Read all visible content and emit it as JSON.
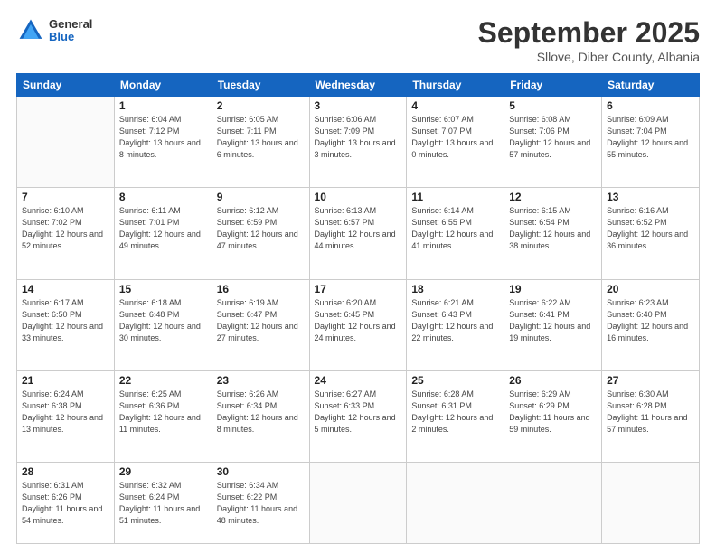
{
  "header": {
    "logo_general": "General",
    "logo_blue": "Blue",
    "month_title": "September 2025",
    "location": "Sllove, Diber County, Albania"
  },
  "weekdays": [
    "Sunday",
    "Monday",
    "Tuesday",
    "Wednesday",
    "Thursday",
    "Friday",
    "Saturday"
  ],
  "weeks": [
    [
      {
        "day": "",
        "sunrise": "",
        "sunset": "",
        "daylight": ""
      },
      {
        "day": "1",
        "sunrise": "Sunrise: 6:04 AM",
        "sunset": "Sunset: 7:12 PM",
        "daylight": "Daylight: 13 hours and 8 minutes."
      },
      {
        "day": "2",
        "sunrise": "Sunrise: 6:05 AM",
        "sunset": "Sunset: 7:11 PM",
        "daylight": "Daylight: 13 hours and 6 minutes."
      },
      {
        "day": "3",
        "sunrise": "Sunrise: 6:06 AM",
        "sunset": "Sunset: 7:09 PM",
        "daylight": "Daylight: 13 hours and 3 minutes."
      },
      {
        "day": "4",
        "sunrise": "Sunrise: 6:07 AM",
        "sunset": "Sunset: 7:07 PM",
        "daylight": "Daylight: 13 hours and 0 minutes."
      },
      {
        "day": "5",
        "sunrise": "Sunrise: 6:08 AM",
        "sunset": "Sunset: 7:06 PM",
        "daylight": "Daylight: 12 hours and 57 minutes."
      },
      {
        "day": "6",
        "sunrise": "Sunrise: 6:09 AM",
        "sunset": "Sunset: 7:04 PM",
        "daylight": "Daylight: 12 hours and 55 minutes."
      }
    ],
    [
      {
        "day": "7",
        "sunrise": "Sunrise: 6:10 AM",
        "sunset": "Sunset: 7:02 PM",
        "daylight": "Daylight: 12 hours and 52 minutes."
      },
      {
        "day": "8",
        "sunrise": "Sunrise: 6:11 AM",
        "sunset": "Sunset: 7:01 PM",
        "daylight": "Daylight: 12 hours and 49 minutes."
      },
      {
        "day": "9",
        "sunrise": "Sunrise: 6:12 AM",
        "sunset": "Sunset: 6:59 PM",
        "daylight": "Daylight: 12 hours and 47 minutes."
      },
      {
        "day": "10",
        "sunrise": "Sunrise: 6:13 AM",
        "sunset": "Sunset: 6:57 PM",
        "daylight": "Daylight: 12 hours and 44 minutes."
      },
      {
        "day": "11",
        "sunrise": "Sunrise: 6:14 AM",
        "sunset": "Sunset: 6:55 PM",
        "daylight": "Daylight: 12 hours and 41 minutes."
      },
      {
        "day": "12",
        "sunrise": "Sunrise: 6:15 AM",
        "sunset": "Sunset: 6:54 PM",
        "daylight": "Daylight: 12 hours and 38 minutes."
      },
      {
        "day": "13",
        "sunrise": "Sunrise: 6:16 AM",
        "sunset": "Sunset: 6:52 PM",
        "daylight": "Daylight: 12 hours and 36 minutes."
      }
    ],
    [
      {
        "day": "14",
        "sunrise": "Sunrise: 6:17 AM",
        "sunset": "Sunset: 6:50 PM",
        "daylight": "Daylight: 12 hours and 33 minutes."
      },
      {
        "day": "15",
        "sunrise": "Sunrise: 6:18 AM",
        "sunset": "Sunset: 6:48 PM",
        "daylight": "Daylight: 12 hours and 30 minutes."
      },
      {
        "day": "16",
        "sunrise": "Sunrise: 6:19 AM",
        "sunset": "Sunset: 6:47 PM",
        "daylight": "Daylight: 12 hours and 27 minutes."
      },
      {
        "day": "17",
        "sunrise": "Sunrise: 6:20 AM",
        "sunset": "Sunset: 6:45 PM",
        "daylight": "Daylight: 12 hours and 24 minutes."
      },
      {
        "day": "18",
        "sunrise": "Sunrise: 6:21 AM",
        "sunset": "Sunset: 6:43 PM",
        "daylight": "Daylight: 12 hours and 22 minutes."
      },
      {
        "day": "19",
        "sunrise": "Sunrise: 6:22 AM",
        "sunset": "Sunset: 6:41 PM",
        "daylight": "Daylight: 12 hours and 19 minutes."
      },
      {
        "day": "20",
        "sunrise": "Sunrise: 6:23 AM",
        "sunset": "Sunset: 6:40 PM",
        "daylight": "Daylight: 12 hours and 16 minutes."
      }
    ],
    [
      {
        "day": "21",
        "sunrise": "Sunrise: 6:24 AM",
        "sunset": "Sunset: 6:38 PM",
        "daylight": "Daylight: 12 hours and 13 minutes."
      },
      {
        "day": "22",
        "sunrise": "Sunrise: 6:25 AM",
        "sunset": "Sunset: 6:36 PM",
        "daylight": "Daylight: 12 hours and 11 minutes."
      },
      {
        "day": "23",
        "sunrise": "Sunrise: 6:26 AM",
        "sunset": "Sunset: 6:34 PM",
        "daylight": "Daylight: 12 hours and 8 minutes."
      },
      {
        "day": "24",
        "sunrise": "Sunrise: 6:27 AM",
        "sunset": "Sunset: 6:33 PM",
        "daylight": "Daylight: 12 hours and 5 minutes."
      },
      {
        "day": "25",
        "sunrise": "Sunrise: 6:28 AM",
        "sunset": "Sunset: 6:31 PM",
        "daylight": "Daylight: 12 hours and 2 minutes."
      },
      {
        "day": "26",
        "sunrise": "Sunrise: 6:29 AM",
        "sunset": "Sunset: 6:29 PM",
        "daylight": "Daylight: 11 hours and 59 minutes."
      },
      {
        "day": "27",
        "sunrise": "Sunrise: 6:30 AM",
        "sunset": "Sunset: 6:28 PM",
        "daylight": "Daylight: 11 hours and 57 minutes."
      }
    ],
    [
      {
        "day": "28",
        "sunrise": "Sunrise: 6:31 AM",
        "sunset": "Sunset: 6:26 PM",
        "daylight": "Daylight: 11 hours and 54 minutes."
      },
      {
        "day": "29",
        "sunrise": "Sunrise: 6:32 AM",
        "sunset": "Sunset: 6:24 PM",
        "daylight": "Daylight: 11 hours and 51 minutes."
      },
      {
        "day": "30",
        "sunrise": "Sunrise: 6:34 AM",
        "sunset": "Sunset: 6:22 PM",
        "daylight": "Daylight: 11 hours and 48 minutes."
      },
      {
        "day": "",
        "sunrise": "",
        "sunset": "",
        "daylight": ""
      },
      {
        "day": "",
        "sunrise": "",
        "sunset": "",
        "daylight": ""
      },
      {
        "day": "",
        "sunrise": "",
        "sunset": "",
        "daylight": ""
      },
      {
        "day": "",
        "sunrise": "",
        "sunset": "",
        "daylight": ""
      }
    ]
  ]
}
